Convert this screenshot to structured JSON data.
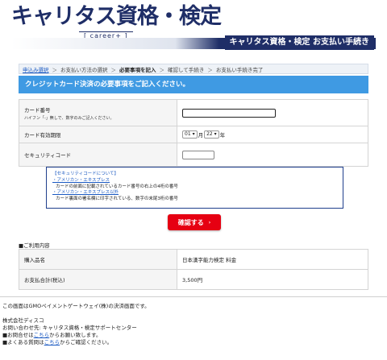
{
  "header": {
    "logo_main": "キャリタス資格・検定",
    "logo_sub": "[ career+ ]",
    "bar_title": "キャリタス資格・検定 お支払い手続き",
    "colors": {
      "navy": "#1f2e67"
    }
  },
  "breadcrumb": {
    "items": [
      {
        "label": "申込み選択",
        "type": "link"
      },
      {
        "label": "お支払い方法の選択",
        "type": "normal"
      },
      {
        "label": "必要事項を記入",
        "type": "active"
      },
      {
        "label": "確認して手続き",
        "type": "normal"
      },
      {
        "label": "お支払い手続き完了",
        "type": "normal"
      }
    ],
    "separator": "＞"
  },
  "section_title": "クレジットカード決済の必要事項をご記入ください。",
  "form": {
    "card_number_label": "カード番号",
    "card_number_hint": "ハイフン「-」無しで、数字のみご記入ください。",
    "card_number_value": "",
    "expiry_label": "カード有効期限",
    "expiry_month": "01",
    "expiry_month_unit": "月",
    "expiry_year": "22",
    "expiry_year_unit": "年",
    "security_label": "セキュリティコード",
    "security_value": ""
  },
  "info_box": {
    "title": "【セキュリティコードについて】",
    "amex_label": "・アメリカン・エキスプレス",
    "amex_text": "カードの前面に記載されているカード番号の右上の4桁の番号",
    "other_label": "・アメリカン・エキスプレス以外",
    "other_text": "カード裏面の署名欄に印字されている、数字の末尾3桁の番号"
  },
  "confirm_button": {
    "label": "確認する",
    "arrow": "›",
    "color": "#e60012"
  },
  "usage": {
    "heading": "■ご利用内容",
    "rows": [
      {
        "label": "購入品名",
        "value": "日本漢字能力検定 料金"
      },
      {
        "label": "お支払合計(税込)",
        "value": "3,500円"
      }
    ]
  },
  "footer": {
    "gmo_note": "この画面はGMOペイメントゲートウェイ(株)の決済画面です。",
    "company": "株式会社ディスコ",
    "contact": "お問い合わせ先: キャリタス資格・検定サポートセンター",
    "inquiry_prefix": "■お問合せは",
    "inquiry_link": "こちら",
    "inquiry_suffix": "からお願い致します。",
    "faq_prefix": "■よくある質問は",
    "faq_link": "こちら",
    "faq_suffix": "からご確認ください。"
  }
}
